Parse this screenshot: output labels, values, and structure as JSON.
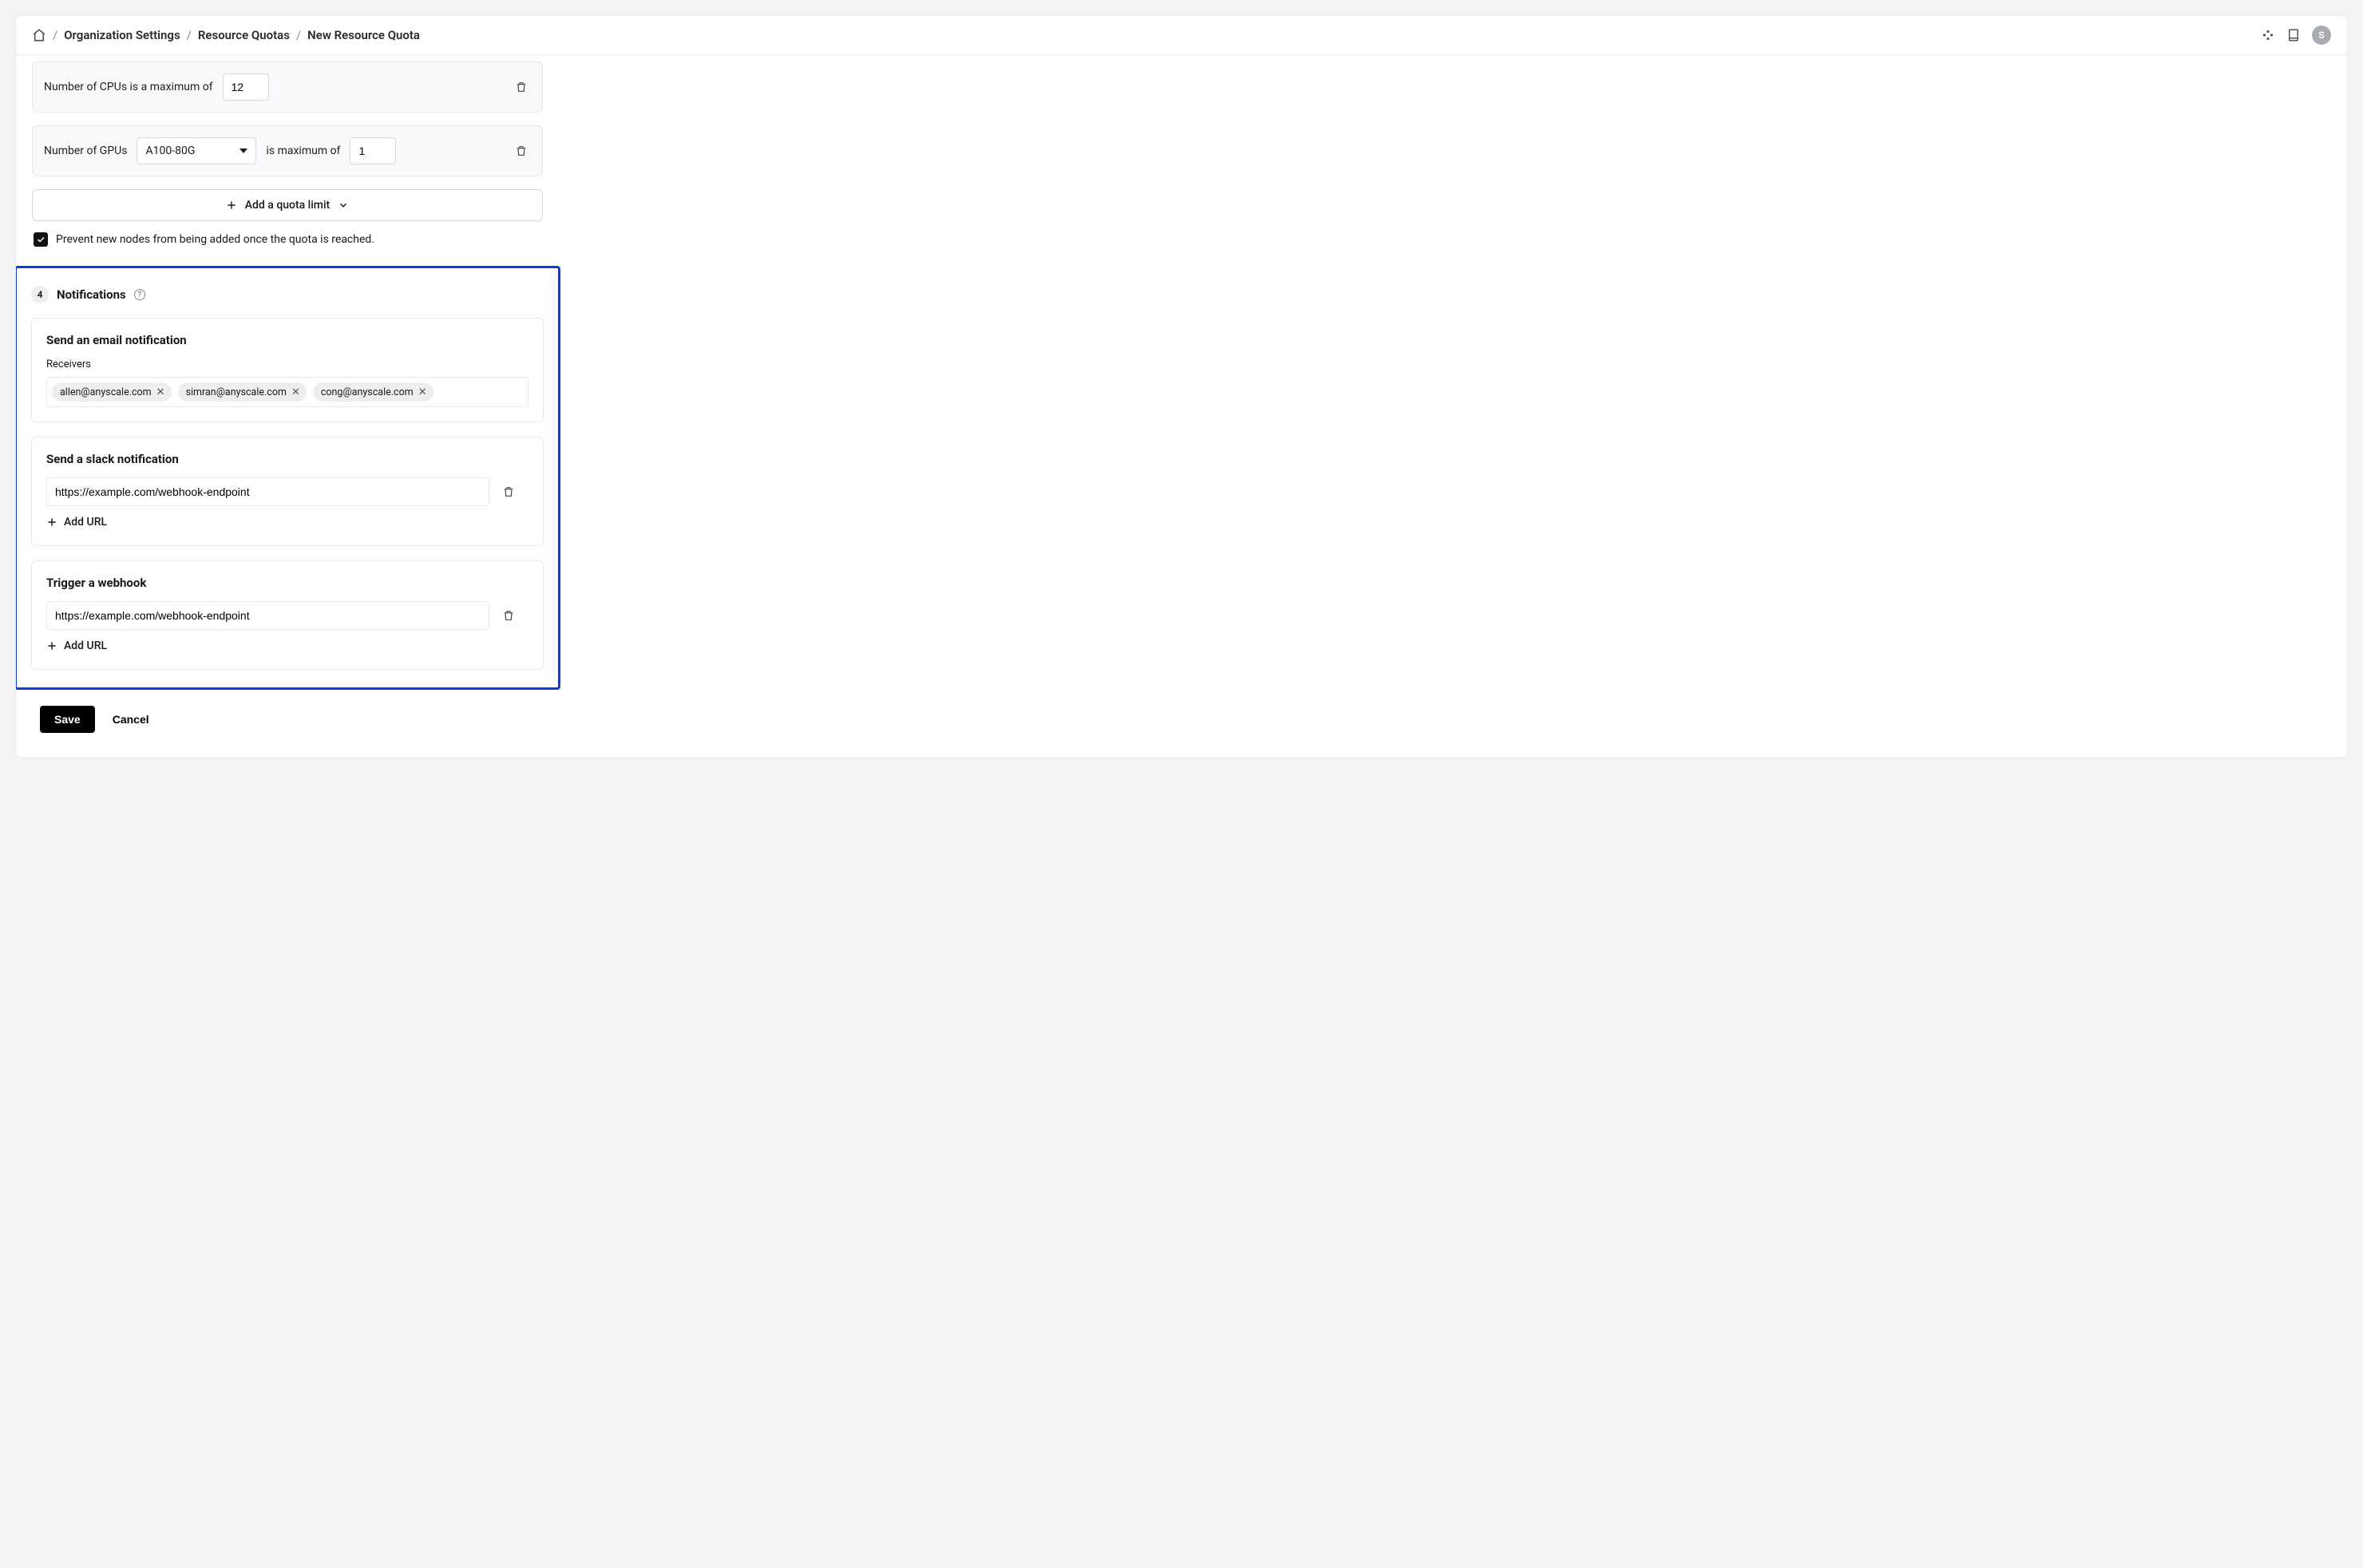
{
  "header": {
    "breadcrumbs": [
      "Organization Settings",
      "Resource Quotas",
      "New Resource Quota"
    ],
    "avatar_initial": "S"
  },
  "quotas": {
    "cpu": {
      "label": "Number of CPUs is a maximum of",
      "value": "12"
    },
    "gpu": {
      "prefix": "Number of GPUs",
      "type": "A100-80G",
      "suffix": "is maximum of",
      "value": "1"
    },
    "add_button": "Add a quota limit",
    "prevent_checkbox_label": "Prevent new nodes from being added once the quota is reached.",
    "prevent_checked": true
  },
  "notifications": {
    "step": "4",
    "title": "Notifications",
    "email": {
      "title": "Send an email notification",
      "receivers_label": "Receivers",
      "receivers": [
        "allen@anyscale.com",
        "simran@anyscale.com",
        "cong@anyscale.com"
      ]
    },
    "slack": {
      "title": "Send a slack notification",
      "url": "https://example.com/webhook-endpoint",
      "add_label": "Add URL"
    },
    "webhook": {
      "title": "Trigger a webhook",
      "url": "https://example.com/webhook-endpoint",
      "add_label": "Add URL"
    }
  },
  "footer": {
    "save": "Save",
    "cancel": "Cancel"
  }
}
